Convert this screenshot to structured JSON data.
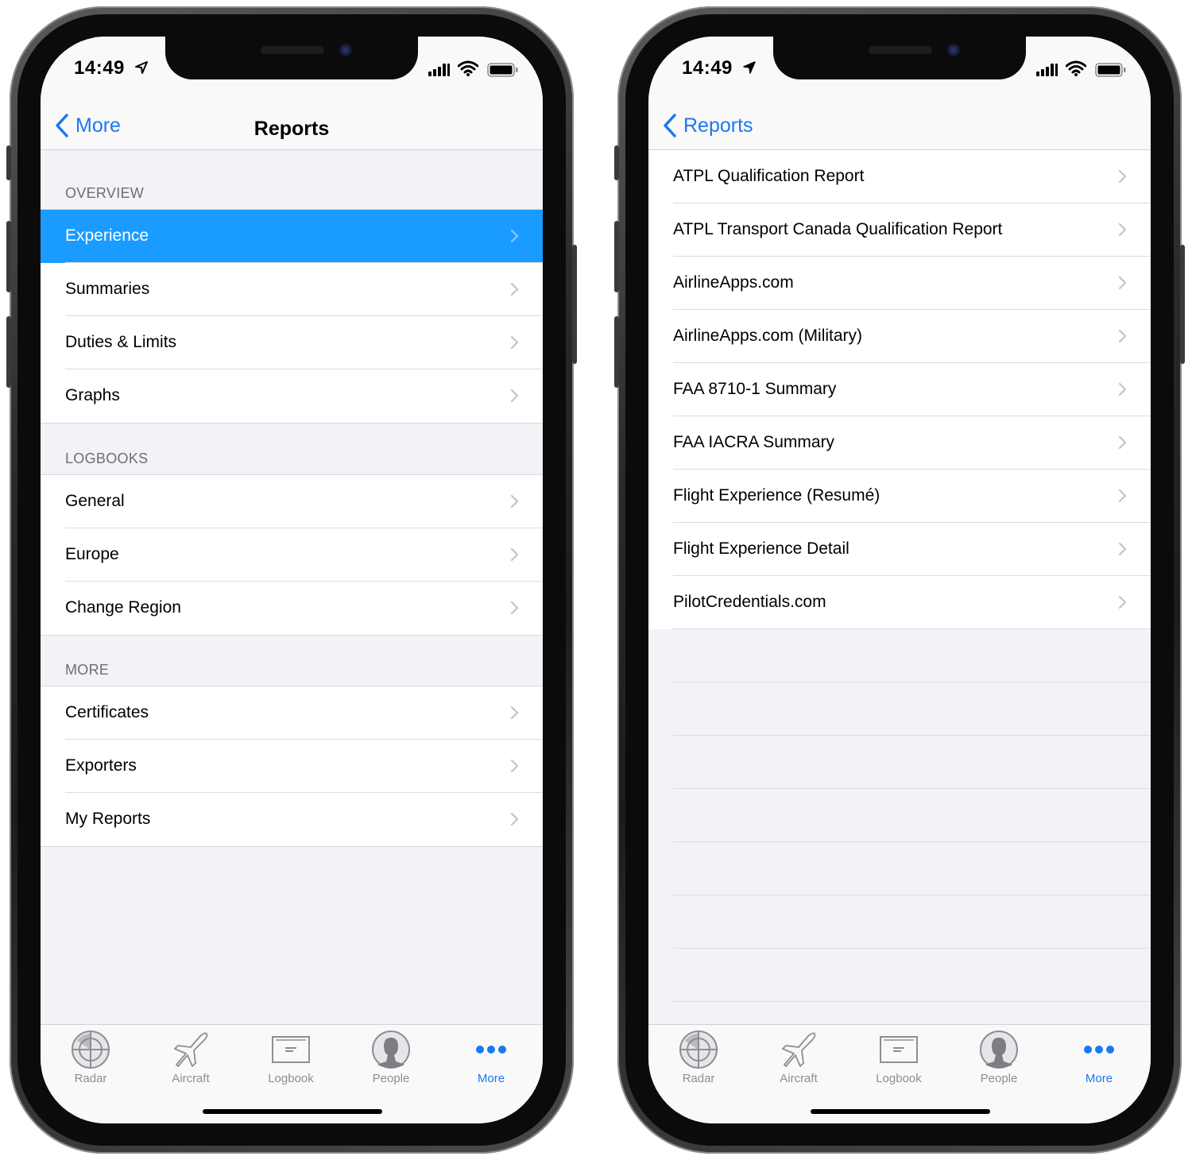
{
  "status": {
    "time": "14:49"
  },
  "left": {
    "nav": {
      "back_label": "More",
      "title": "Reports"
    },
    "sections": [
      {
        "header": "OVERVIEW",
        "items": [
          "Experience",
          "Summaries",
          "Duties & Limits",
          "Graphs"
        ]
      },
      {
        "header": "LOGBOOKS",
        "items": [
          "General",
          "Europe",
          "Change Region"
        ]
      },
      {
        "header": "MORE",
        "items": [
          "Certificates",
          "Exporters",
          "My Reports"
        ]
      }
    ],
    "selected_item": "Experience"
  },
  "right": {
    "nav": {
      "back_label": "Reports"
    },
    "items": [
      "ATPL Qualification Report",
      "ATPL Transport Canada Qualification Report",
      "AirlineApps.com",
      "AirlineApps.com (Military)",
      "FAA 8710-1 Summary",
      "FAA IACRA Summary",
      "Flight Experience (Resumé)",
      "Flight Experience Detail",
      "PilotCredentials.com"
    ]
  },
  "tabbar": {
    "tabs": [
      {
        "label": "Radar",
        "icon": "radar-icon"
      },
      {
        "label": "Aircraft",
        "icon": "aircraft-icon"
      },
      {
        "label": "Logbook",
        "icon": "logbook-icon"
      },
      {
        "label": "People",
        "icon": "people-icon"
      },
      {
        "label": "More",
        "icon": "more-dots-icon"
      }
    ],
    "active": "More"
  },
  "colors": {
    "accent": "#1a78f2",
    "selected_row": "#1a9bff",
    "background": "#f2f2f7",
    "inactive_tab": "#8e8e93"
  }
}
